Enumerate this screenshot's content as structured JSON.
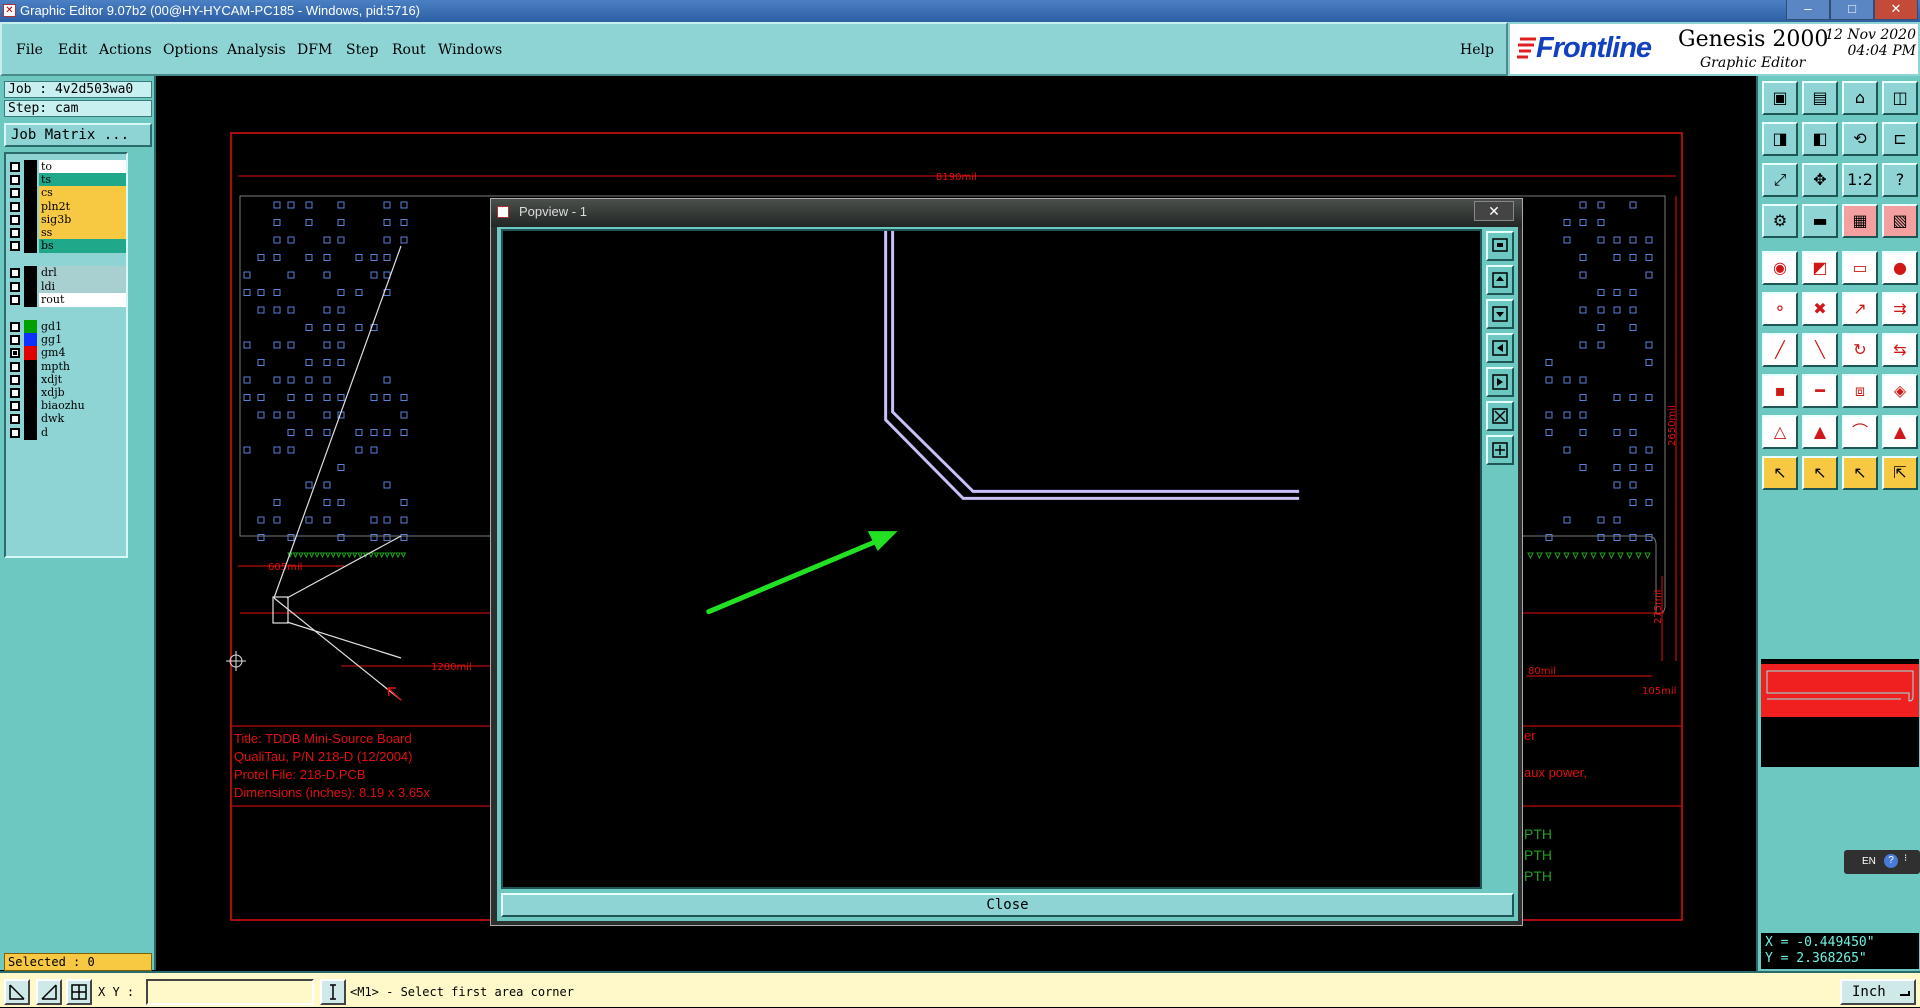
{
  "window": {
    "title": "Graphic Editor 9.07b2 (00@HY-HYCAM-PC185 - Windows, pid:5716)",
    "controls": [
      "–",
      "□",
      "✕"
    ]
  },
  "menu": {
    "items": [
      "File",
      "Edit",
      "Actions",
      "Options",
      "Analysis",
      "DFM",
      "Step",
      "Rout",
      "Windows"
    ],
    "help": "Help"
  },
  "brand": {
    "logo": "Frontline",
    "product": "Genesis 2000",
    "subtitle": "Graphic Editor",
    "date": "12 Nov 2020",
    "time": "04:04 PM"
  },
  "job": {
    "job_line": "Job : 4v2d503wa0",
    "step_line": "Step: cam",
    "matrix_button": "Job Matrix ..."
  },
  "layers": [
    {
      "name": "to",
      "color": "#ffffff",
      "checked": false
    },
    {
      "name": "ts",
      "color": "#1fa88a",
      "checked": false
    },
    {
      "name": "cs",
      "color": "#f7c942",
      "checked": false
    },
    {
      "name": "pln2t",
      "color": "#f7c942",
      "checked": false
    },
    {
      "name": "sig3b",
      "color": "#f7c942",
      "checked": false
    },
    {
      "name": "ss",
      "color": "#f7c942",
      "checked": false
    },
    {
      "name": "bs",
      "color": "#1fa88a",
      "checked": false
    },
    {
      "name": "drl",
      "color": "#a8d0d0",
      "checked": false
    },
    {
      "name": "ldi",
      "color": "#a8d0d0",
      "checked": false
    },
    {
      "name": "rout",
      "color": "#ffffff",
      "checked": false
    },
    {
      "name": "gd1",
      "color": "#8ed4d4",
      "checked": false,
      "swatch": "#00a000"
    },
    {
      "name": "gg1",
      "color": "#8ed4d4",
      "checked": false,
      "swatch": "#1030ff"
    },
    {
      "name": "gm4",
      "color": "#8ed4d4",
      "checked": true,
      "swatch": "#e00000"
    },
    {
      "name": "mpth",
      "color": "#8ed4d4",
      "checked": false
    },
    {
      "name": "xdjt",
      "color": "#8ed4d4",
      "checked": false
    },
    {
      "name": "xdjb",
      "color": "#8ed4d4",
      "checked": false
    },
    {
      "name": "biaozhu",
      "color": "#8ed4d4",
      "checked": false
    },
    {
      "name": "dwk",
      "color": "#8ed4d4",
      "checked": false
    },
    {
      "name": "d",
      "color": "#8ed4d4",
      "checked": false
    }
  ],
  "selected": "Selected : 0",
  "drawing": {
    "dim_top": "8190mil",
    "dim_left": "605mil",
    "dim_bottom": "1280mil",
    "dim_right": "2650mil",
    "dim_right_small": "275mil",
    "dim_right_bottom": "105mil",
    "dim_right_mid": "80mil",
    "title_block": [
      "Title: TDDB Mini-Source Board",
      "QualiTau, P/N 218-D  (12/2004)",
      "Protel File: 218-D.PCB",
      "Dimensions (inches): 8.19 x 3.65x"
    ],
    "notes_right": [
      "er",
      "aux power,"
    ],
    "pth_labels": [
      "PTH",
      "PTH",
      "PTH"
    ]
  },
  "popview": {
    "title": "Popview - 1",
    "close_x": "✕",
    "close_label": "Close"
  },
  "coords": {
    "x": "X = -0.449450\"",
    "y": "Y = 2.368265\""
  },
  "lang": "EN",
  "status": {
    "xy_label": "X Y :",
    "xy_value": "",
    "prompt": "<M1> - Select first area corner",
    "unit": "Inch"
  },
  "colors": {
    "panel": "#6cc8c0",
    "menu": "#8ed4d4",
    "outline": "#e01010",
    "trace": "#c8c0f8",
    "arrow": "#22e022",
    "pad": "#5a82d8"
  }
}
